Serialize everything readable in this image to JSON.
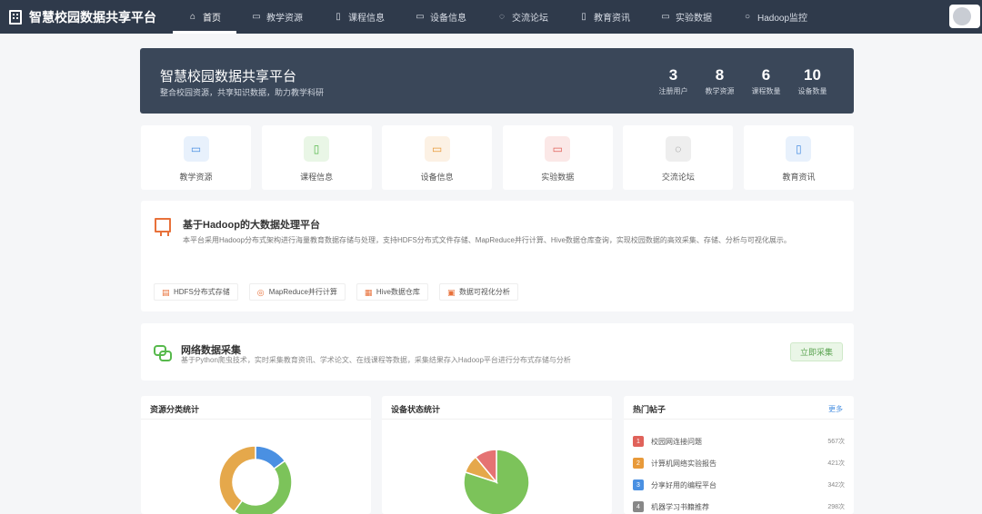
{
  "nav": {
    "brand": "智慧校园数据共享平台",
    "items": [
      {
        "label": "首页",
        "icon": "home-icon",
        "active": true
      },
      {
        "label": "教学资源",
        "icon": "folder-icon"
      },
      {
        "label": "课程信息",
        "icon": "book-icon"
      },
      {
        "label": "设备信息",
        "icon": "monitor-icon"
      },
      {
        "label": "交流论坛",
        "icon": "chat-icon"
      },
      {
        "label": "教育资讯",
        "icon": "news-icon"
      },
      {
        "label": "实验数据",
        "icon": "screen-icon"
      },
      {
        "label": "Hadoop监控",
        "icon": "circle-icon"
      }
    ]
  },
  "hero": {
    "title": "智慧校园数据共享平台",
    "subtitle": "整合校园资源，共享知识数据，助力教学科研",
    "stats": [
      {
        "value": "3",
        "label": "注册用户"
      },
      {
        "value": "8",
        "label": "教学资源"
      },
      {
        "value": "6",
        "label": "课程数量"
      },
      {
        "value": "10",
        "label": "设备数量"
      }
    ]
  },
  "quick": [
    {
      "label": "教学资源",
      "icon": "folder-icon",
      "color": "#4a90e2",
      "bg": "#e8f1fc"
    },
    {
      "label": "课程信息",
      "icon": "book-icon",
      "color": "#57b94c",
      "bg": "#e9f6e6"
    },
    {
      "label": "设备信息",
      "icon": "monitor-icon",
      "color": "#e89a3a",
      "bg": "#fcf1e4"
    },
    {
      "label": "实验数据",
      "icon": "presentation-icon",
      "color": "#e0625a",
      "bg": "#fbe8e7"
    },
    {
      "label": "交流论坛",
      "icon": "chat-icon",
      "color": "#777777",
      "bg": "#eeeeee"
    },
    {
      "label": "教育资讯",
      "icon": "news-icon",
      "color": "#4a90e2",
      "bg": "#e8f1fc"
    }
  ],
  "platform": {
    "title": "基于Hadoop的大数据处理平台",
    "desc": "本平台采用Hadoop分布式架构进行海量教育数据存储与处理，支持HDFS分布式文件存储、MapReduce并行计算、Hive数据仓库查询，实现校园数据的高效采集、存储、分析与可视化展示。",
    "tags": [
      {
        "label": "HDFS分布式存储",
        "icon": "database-icon",
        "color": "#e8713a"
      },
      {
        "label": "MapReduce并行计算",
        "icon": "gear-icon",
        "color": "#e8713a"
      },
      {
        "label": "Hive数据仓库",
        "icon": "grid-icon",
        "color": "#e8713a"
      },
      {
        "label": "数据可视化分析",
        "icon": "chart-icon",
        "color": "#e8713a"
      }
    ]
  },
  "crawler": {
    "title": "网络数据采集",
    "desc": "基于Python爬虫技术，实时采集教育资讯、学术论文、在线课程等数据，采集结果存入Hadoop平台进行分布式存储与分析",
    "button": "立即采集"
  },
  "panels": {
    "resource_title": "资源分类统计",
    "device_title": "设备状态统计",
    "hot_title": "热门帖子",
    "more": "更多"
  },
  "hot_posts": [
    {
      "rank": "1",
      "title": "校园网连接问题",
      "count": "567次",
      "color": "#e0625a"
    },
    {
      "rank": "2",
      "title": "计算机网络实验报告",
      "count": "421次",
      "color": "#e89a3a"
    },
    {
      "rank": "3",
      "title": "分享好用的编程平台",
      "count": "342次",
      "color": "#4a90e2"
    },
    {
      "rank": "4",
      "title": "机器学习书籍推荐",
      "count": "298次",
      "color": "#888888"
    }
  ],
  "chart_data": [
    {
      "type": "pie",
      "variant": "donut",
      "categories": [
        "",
        "",
        ""
      ],
      "values": [
        15,
        45,
        40
      ],
      "colors": [
        "#4a90e2",
        "#7cc35a",
        "#e5a84b"
      ]
    },
    {
      "type": "pie",
      "categories": [
        "",
        "",
        ""
      ],
      "values": [
        80,
        9,
        11
      ],
      "colors": [
        "#7cc35a",
        "#e5a84b",
        "#e57373"
      ]
    }
  ]
}
